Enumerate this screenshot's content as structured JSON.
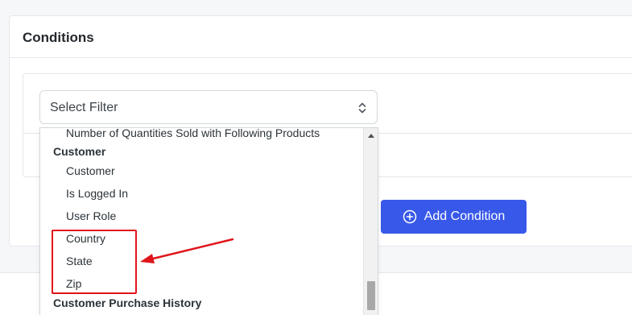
{
  "card": {
    "title": "Conditions"
  },
  "select": {
    "placeholder": "Select Filter"
  },
  "add_button": {
    "label": "Add Condition"
  },
  "dropdown": {
    "partial_top": "Number of Quantities Sold with Following Products",
    "group_customer": "Customer",
    "items": [
      "Customer",
      "Is Logged In",
      "User Role",
      "Country",
      "State",
      "Zip"
    ],
    "group_history": "Customer Purchase History"
  },
  "colors": {
    "primary": "#3858e9",
    "annotation": "#e0151b"
  }
}
